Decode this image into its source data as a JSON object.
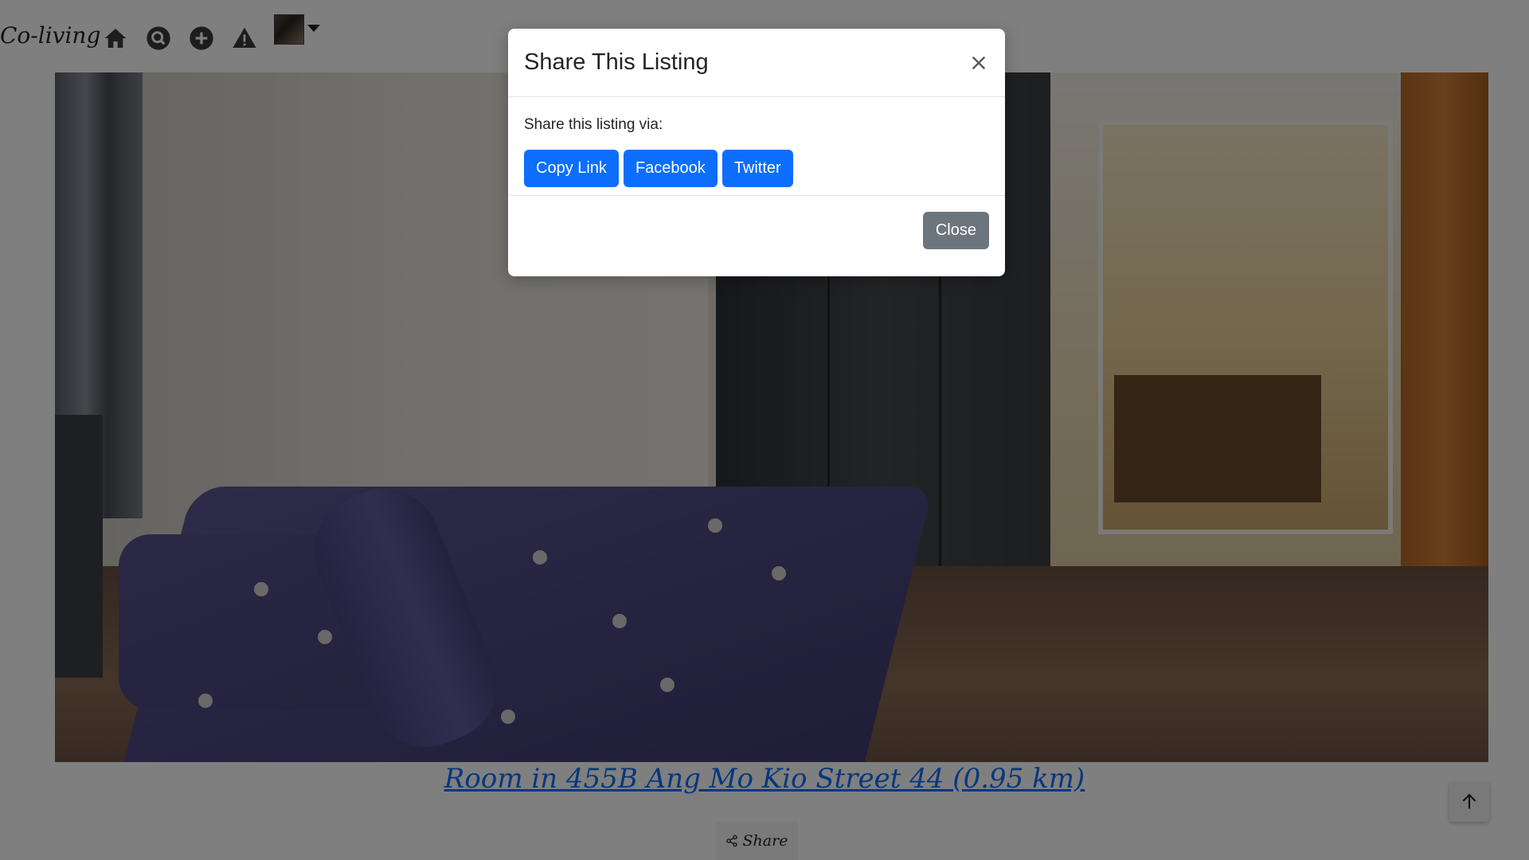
{
  "navbar": {
    "brand": "Co-living",
    "icons": [
      "home-icon",
      "search-icon",
      "add-icon",
      "warning-icon"
    ],
    "avatar": "user-avatar"
  },
  "listing": {
    "title": "Room in 455B Ang Mo Kio Street 44 (0.95 km)",
    "share_label": "Share"
  },
  "modal": {
    "title": "Share This Listing",
    "prompt": "Share this listing via:",
    "buttons": {
      "copy_link": "Copy Link",
      "facebook": "Facebook",
      "twitter": "Twitter"
    },
    "close_label": "Close"
  },
  "colors": {
    "primary": "#0d6efd",
    "secondary": "#6c757d",
    "backdrop": "rgba(0,0,0,0.5)"
  }
}
